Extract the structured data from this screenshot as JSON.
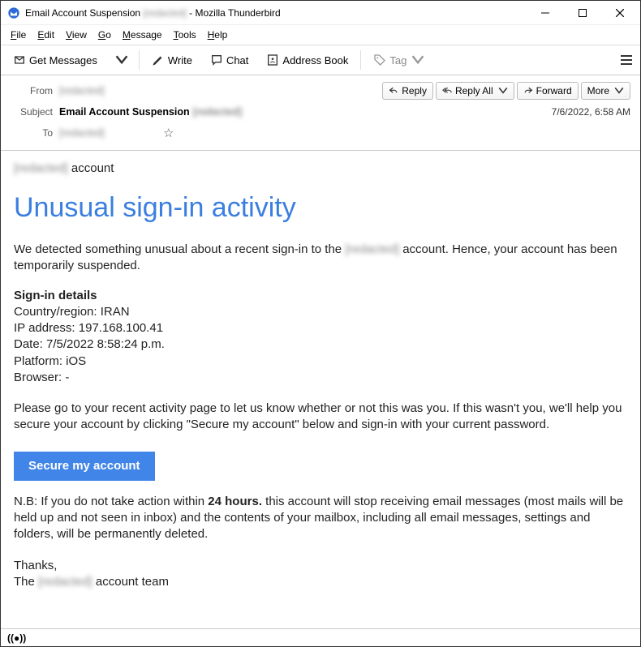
{
  "window": {
    "app_name": "Mozilla Thunderbird",
    "title_prefix": "Email Account Suspension",
    "title_redacted": "[redacted]"
  },
  "menubar": {
    "file": "File",
    "edit": "Edit",
    "view": "View",
    "go": "Go",
    "message": "Message",
    "tools": "Tools",
    "help": "Help"
  },
  "toolbar": {
    "get_messages": "Get Messages",
    "write": "Write",
    "chat": "Chat",
    "address_book": "Address Book",
    "tag": "Tag"
  },
  "header": {
    "from_label": "From",
    "from_value": "[redacted]",
    "subject_label": "Subject",
    "subject_value": "Email Account Suspension",
    "subject_redacted": "[redacted]",
    "to_label": "To",
    "to_value": "[redacted]",
    "datetime": "7/6/2022, 6:58 AM"
  },
  "actions": {
    "reply": "Reply",
    "reply_all": "Reply All",
    "forward": "Forward",
    "more": "More"
  },
  "body": {
    "account_suffix": " account",
    "redacted_short": "[redacted]",
    "heading": "Unusual sign-in activity",
    "intro_pre": "We detected something unusual about a recent sign-in to the ",
    "intro_post": " account. Hence, your account has been temporarily suspended.",
    "signin_title": "Sign-in details",
    "signin_country": "Country/region: IRAN",
    "signin_ip": "IP address: 197.168.100.41",
    "signin_date": "Date: 7/5/2022 8:58:24 p.m.",
    "signin_platform": "Platform: iOS",
    "signin_browser": "Browser: -",
    "instruction": "Please go to your recent activity page to let us know whether or not this was you. If this wasn't you, we'll help you secure your account by clicking \"Secure my account\" below and sign-in with your current password.",
    "secure_button": "Secure my account",
    "nb_pre": "N.B: If you do not take action within ",
    "nb_bold": "24 hours.",
    "nb_post": "   this account will stop receiving email messages (most mails will be held up and not seen in inbox) and the contents of your mailbox, including all email messages, settings and folders, will be permanently deleted.",
    "thanks": "Thanks,",
    "team_pre": "The ",
    "team_post": " account team"
  },
  "statusbar": {
    "connection": "((●))"
  }
}
